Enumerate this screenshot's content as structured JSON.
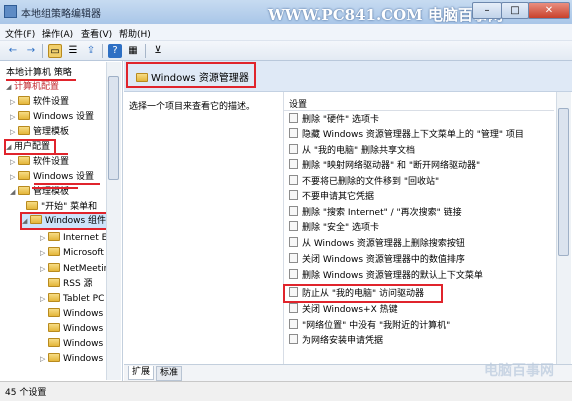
{
  "window": {
    "title": "本地组策略编辑器",
    "watermark": "WWW.PC841.COM 电脑百事网",
    "min_symbol": "–",
    "max_symbol": "□",
    "close_symbol": "✕"
  },
  "menu": [
    "文件(F)",
    "操作(A)",
    "查看(V)",
    "帮助(H)"
  ],
  "toolbar": {
    "back": "←",
    "forward": "→",
    "folder": "▭",
    "list": "☰",
    "export": "⇪",
    "help": "?",
    "view": "▦",
    "filter": "⊻"
  },
  "tree": {
    "root": "本地计算机 策略",
    "computer_config": "计算机配置",
    "items": [
      {
        "label": "软件设置",
        "arrow": "▷"
      },
      {
        "label": "Windows 设置",
        "arrow": "▷"
      },
      {
        "label": "管理模板",
        "arrow": "▷"
      }
    ],
    "user_config": "用户配置",
    "user_items": [
      {
        "label": "软件设置",
        "arrow": "▷"
      },
      {
        "label": "Windows 设置",
        "arrow": "▷"
      },
      {
        "label": "管理模板",
        "arrow": "◢"
      },
      {
        "label": "\"开始\" 菜单和",
        "arrow": ""
      },
      {
        "label": "Windows 组件",
        "arrow": "◢"
      },
      {
        "label": "Internet Ex",
        "arrow": "▷"
      },
      {
        "label": "Microsoft",
        "arrow": "▷"
      },
      {
        "label": "NetMeetin",
        "arrow": "▷"
      },
      {
        "label": "RSS 源",
        "arrow": ""
      },
      {
        "label": "Tablet PC",
        "arrow": "▷"
      },
      {
        "label": "Windows",
        "arrow": ""
      },
      {
        "label": "Windows",
        "arrow": ""
      },
      {
        "label": "Windows",
        "arrow": ""
      },
      {
        "label": "Windows",
        "arrow": "▷"
      }
    ]
  },
  "header": {
    "title": "Windows 资源管理器"
  },
  "description": "选择一个项目来查看它的描述。",
  "settings": {
    "column_header": "设置",
    "items": [
      "删除 \"硬件\" 选项卡",
      "隐藏 Windows 资源管理器上下文菜单上的 \"管理\" 项目",
      "从 \"我的电脑\" 删除共享文档",
      "删除 \"映射网络驱动器\" 和 \"断开网络驱动器\"",
      "不要将已删除的文件移到 \"回收站\"",
      "不要申请其它凭据",
      "删除 \"搜索 Internet\" / \"再次搜索\" 链接",
      "删除 \"安全\" 选项卡",
      "从 Windows 资源管理器上删除搜索按钮",
      "关闭 Windows 资源管理器中的数值排序",
      "删除 Windows 资源管理器的默认上下文菜单",
      "防止从 \"我的电脑\" 访问驱动器",
      "关闭 Windows+X 热键",
      "\"网络位置\" 中没有 \"我附近的计算机\"",
      "为网络安装申请凭据"
    ]
  },
  "tabs": [
    "扩展",
    "标准"
  ],
  "status": "45 个设置",
  "logo": "电脑百事网",
  "colors": {
    "highlight_red": "#e0242c",
    "header_band": "#dfe9f6"
  }
}
